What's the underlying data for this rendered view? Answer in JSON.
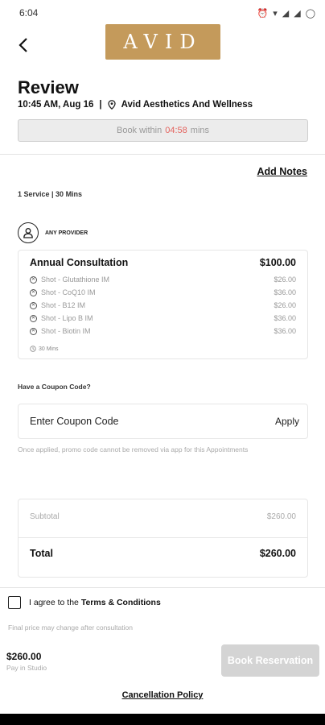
{
  "status_bar": {
    "time": "6:04"
  },
  "header": {
    "logo_text": "AVID",
    "back_label": "‹"
  },
  "page": {
    "title": "Review",
    "datetime": "10:45 AM, Aug 16",
    "separator": "|",
    "location": "Avid Aesthetics And Wellness",
    "book_within_prefix": "Book within",
    "book_within_timer": "04:58",
    "book_within_suffix": "mins"
  },
  "notes": {
    "add_notes_label": "Add Notes"
  },
  "service": {
    "summary": "1 Service | 30 Mins",
    "provider_label": "ANY PROVIDER",
    "name": "Annual Consultation",
    "price": "$100.00",
    "addons": [
      {
        "name": "Shot - Glutathione  IM",
        "price": "$26.00"
      },
      {
        "name": "Shot - CoQ10 IM",
        "price": "$36.00"
      },
      {
        "name": "Shot - B12 IM",
        "price": "$26.00"
      },
      {
        "name": "Shot - Lipo B  IM",
        "price": "$36.00"
      },
      {
        "name": "Shot - Biotin IM",
        "price": "$36.00"
      }
    ],
    "duration": "30 Mins"
  },
  "coupon": {
    "title": "Have a Coupon Code?",
    "placeholder": "Enter Coupon Code",
    "apply_label": "Apply",
    "note": "Once applied, promo code cannot be removed via app for this Appointments"
  },
  "totals": {
    "subtotal_label": "Subtotal",
    "subtotal_value": "$260.00",
    "total_label": "Total",
    "total_value": "$260.00"
  },
  "terms": {
    "prefix": "I agree to the",
    "link": "Terms & Conditions",
    "checked": false,
    "price_note": "Final price may change after consultation"
  },
  "footer": {
    "price": "$260.00",
    "pay_note": "Pay in Studio",
    "book_label": "Book Reservation",
    "cancellation_label": "Cancellation Policy"
  }
}
